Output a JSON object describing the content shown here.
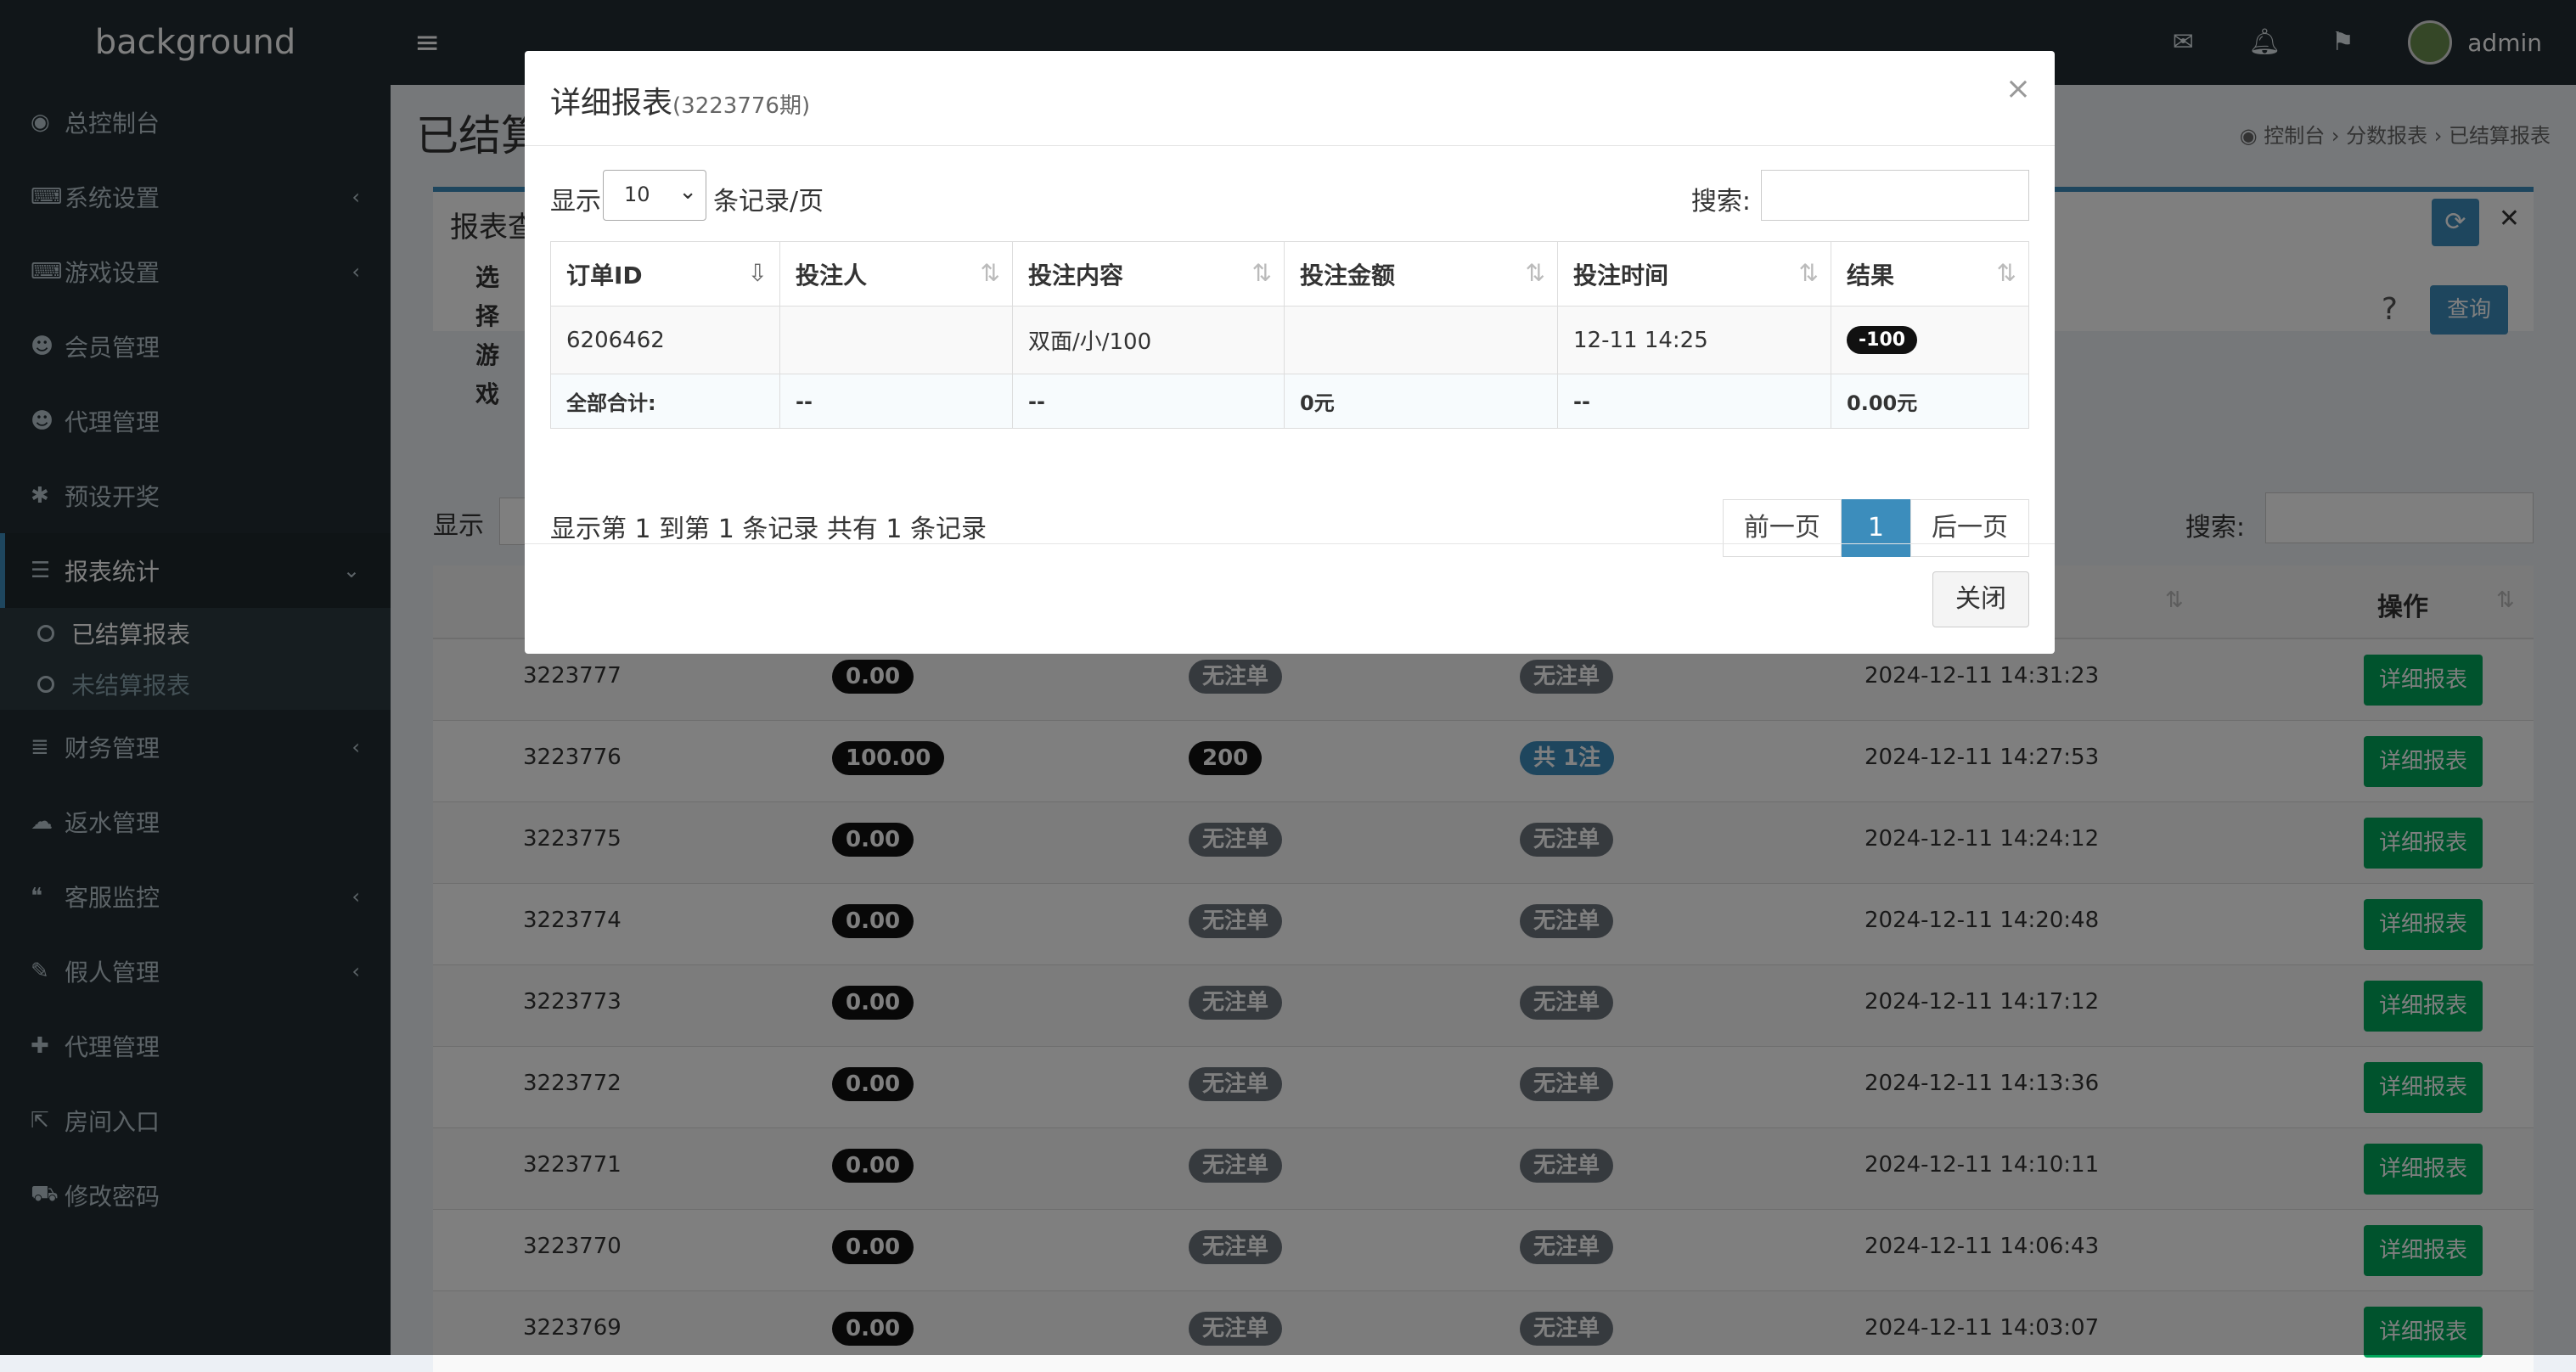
{
  "app": {
    "logo": "background",
    "username": "admin"
  },
  "sidebar": {
    "items": [
      {
        "label": "总控制台",
        "icon": "dashboard-icon",
        "chevron": false
      },
      {
        "label": "系统设置",
        "icon": "gamepad-icon",
        "chevron": true
      },
      {
        "label": "游戏设置",
        "icon": "gamepad-icon",
        "chevron": true
      },
      {
        "label": "会员管理",
        "icon": "users-icon",
        "chevron": false
      },
      {
        "label": "代理管理",
        "icon": "users-icon",
        "chevron": false
      },
      {
        "label": "预设开奖",
        "icon": "settings-icon",
        "chevron": false
      },
      {
        "label": "报表统计",
        "icon": "list-icon",
        "chevron": true,
        "active": true
      },
      {
        "label": "财务管理",
        "icon": "database-icon",
        "chevron": true
      },
      {
        "label": "返水管理",
        "icon": "cloud-icon",
        "chevron": false
      },
      {
        "label": "客服监控",
        "icon": "chat-icon",
        "chevron": true
      },
      {
        "label": "假人管理",
        "icon": "comment-icon",
        "chevron": true
      },
      {
        "label": "代理管理",
        "icon": "user-plus-icon",
        "chevron": false
      },
      {
        "label": "房间入口",
        "icon": "external-icon",
        "chevron": false
      },
      {
        "label": "修改密码",
        "icon": "cart-icon",
        "chevron": false
      }
    ],
    "sub_items": [
      "已结算报表",
      "未结算报表"
    ]
  },
  "page": {
    "title": "已结算报表",
    "breadcrumb": [
      "控制台",
      "分数报表",
      "已结算报表"
    ],
    "box_title": "报表查询",
    "filter_label": "选择游戏",
    "query_button": "查询",
    "show_label": "显示",
    "search_label": "搜索:",
    "op_header": "操作"
  },
  "bg_rows": [
    {
      "id": "3223777",
      "bet": "0.00",
      "b2": "无注单",
      "b3": "无注单",
      "time": "2024-12-11 14:31:23"
    },
    {
      "id": "3223776",
      "bet": "100.00",
      "b2": "200",
      "b3": "共 1注",
      "time": "2024-12-11 14:27:53"
    },
    {
      "id": "3223775",
      "bet": "0.00",
      "b2": "无注单",
      "b3": "无注单",
      "time": "2024-12-11 14:24:12"
    },
    {
      "id": "3223774",
      "bet": "0.00",
      "b2": "无注单",
      "b3": "无注单",
      "time": "2024-12-11 14:20:48"
    },
    {
      "id": "3223773",
      "bet": "0.00",
      "b2": "无注单",
      "b3": "无注单",
      "time": "2024-12-11 14:17:12"
    },
    {
      "id": "3223772",
      "bet": "0.00",
      "b2": "无注单",
      "b3": "无注单",
      "time": "2024-12-11 14:13:36"
    },
    {
      "id": "3223771",
      "bet": "0.00",
      "b2": "无注单",
      "b3": "无注单",
      "time": "2024-12-11 14:10:11"
    },
    {
      "id": "3223770",
      "bet": "0.00",
      "b2": "无注单",
      "b3": "无注单",
      "time": "2024-12-11 14:06:43"
    },
    {
      "id": "3223769",
      "bet": "0.00",
      "b2": "无注单",
      "b3": "无注单",
      "time": "2024-12-11 14:03:07"
    }
  ],
  "bg_detail_label": "详细报表",
  "modal": {
    "title": "详细报表",
    "period": "(3223776期)",
    "close_x": "×",
    "show_label": "显示",
    "page_size": "10",
    "per_page_label": "条记录/页",
    "search_label": "搜索:",
    "headers": [
      "订单ID",
      "投注人",
      "投注内容",
      "投注金额",
      "投注时间",
      "结果"
    ],
    "row": {
      "order_id": "6206462",
      "bettor": "",
      "content": "双面/小/100",
      "amount": "",
      "time": "12-11 14:25",
      "result": "-100"
    },
    "total": {
      "label": "全部合计:",
      "bettor": "--",
      "content": "--",
      "amount": "0元",
      "time": "--",
      "result": "0.00元"
    },
    "info": "显示第 1 到第 1 条记录 共有 1 条记录",
    "prev": "前一页",
    "page": "1",
    "next": "后一页",
    "close_button": "关闭"
  }
}
